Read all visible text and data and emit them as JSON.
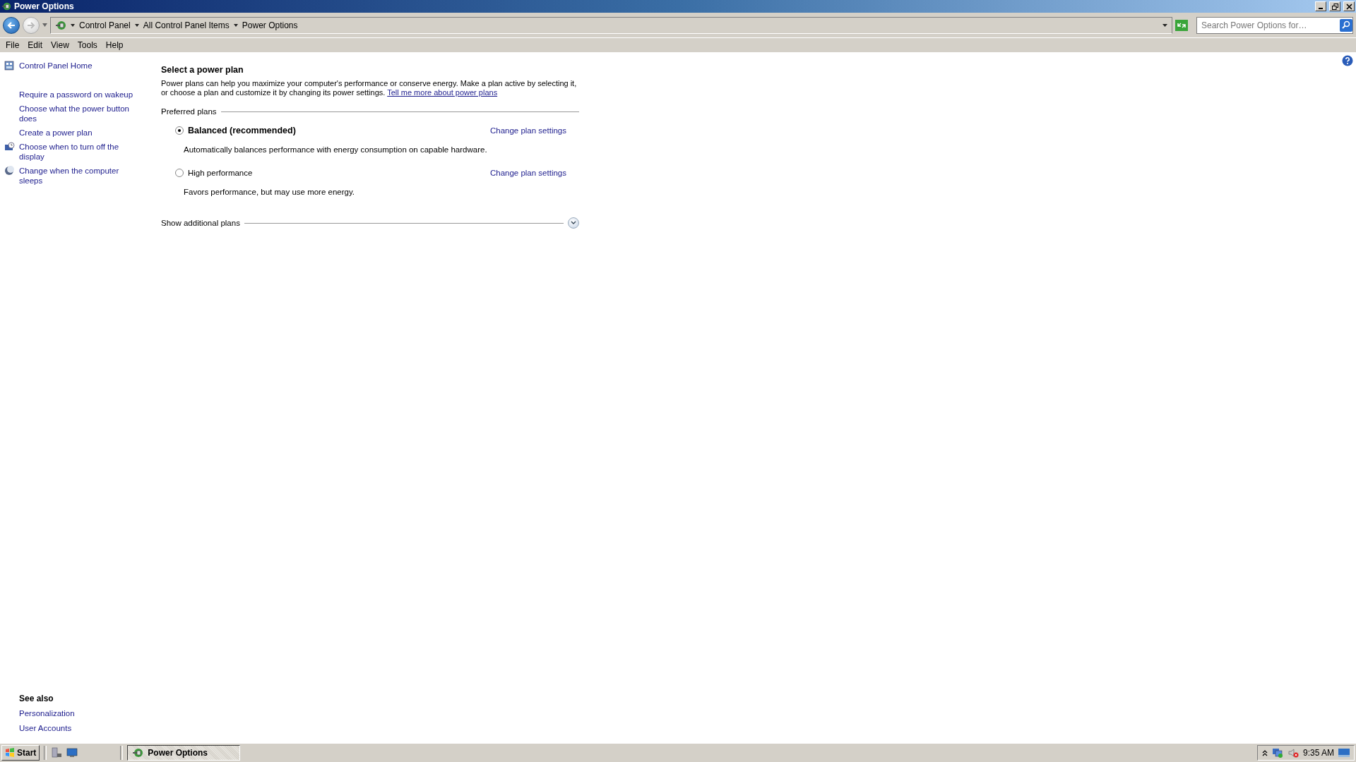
{
  "window": {
    "title": "Power Options"
  },
  "address_bar": {
    "breadcrumbs": [
      "Control Panel",
      "All Control Panel Items",
      "Power Options"
    ]
  },
  "search": {
    "placeholder": "Search Power Options for…"
  },
  "menu": [
    "File",
    "Edit",
    "View",
    "Tools",
    "Help"
  ],
  "sidebar": {
    "items": [
      {
        "label": "Control Panel Home",
        "kind": "home"
      },
      {
        "label": "Require a password on wakeup",
        "kind": "link"
      },
      {
        "label": "Choose what the power button does",
        "kind": "link"
      },
      {
        "label": "Create a power plan",
        "kind": "link"
      },
      {
        "label": "Choose when to turn off the display",
        "kind": "display"
      },
      {
        "label": "Change when the computer sleeps",
        "kind": "sleep"
      }
    ],
    "see_also": {
      "title": "See also",
      "links": [
        "Personalization",
        "User Accounts"
      ]
    }
  },
  "main": {
    "title": "Select a power plan",
    "description": "Power plans can help you maximize your computer's performance or conserve energy. Make a plan active by selecting it, or choose a plan and customize it by changing its power settings.",
    "link": "Tell me more about power plans",
    "section": "Preferred plans",
    "plans": [
      {
        "name": "Balanced (recommended)",
        "description": "Automatically balances performance with energy consumption on capable hardware.",
        "selected": true,
        "link": "Change plan settings"
      },
      {
        "name": "High performance",
        "description": "Favors performance, but may use more energy.",
        "selected": false,
        "link": "Change plan settings"
      }
    ],
    "additional": {
      "label": "Show additional plans",
      "expanded": false
    }
  },
  "taskbar": {
    "start": "Start",
    "tasks": [
      {
        "label": "Power Options",
        "selected": true
      }
    ],
    "clock": "9:35 AM"
  }
}
